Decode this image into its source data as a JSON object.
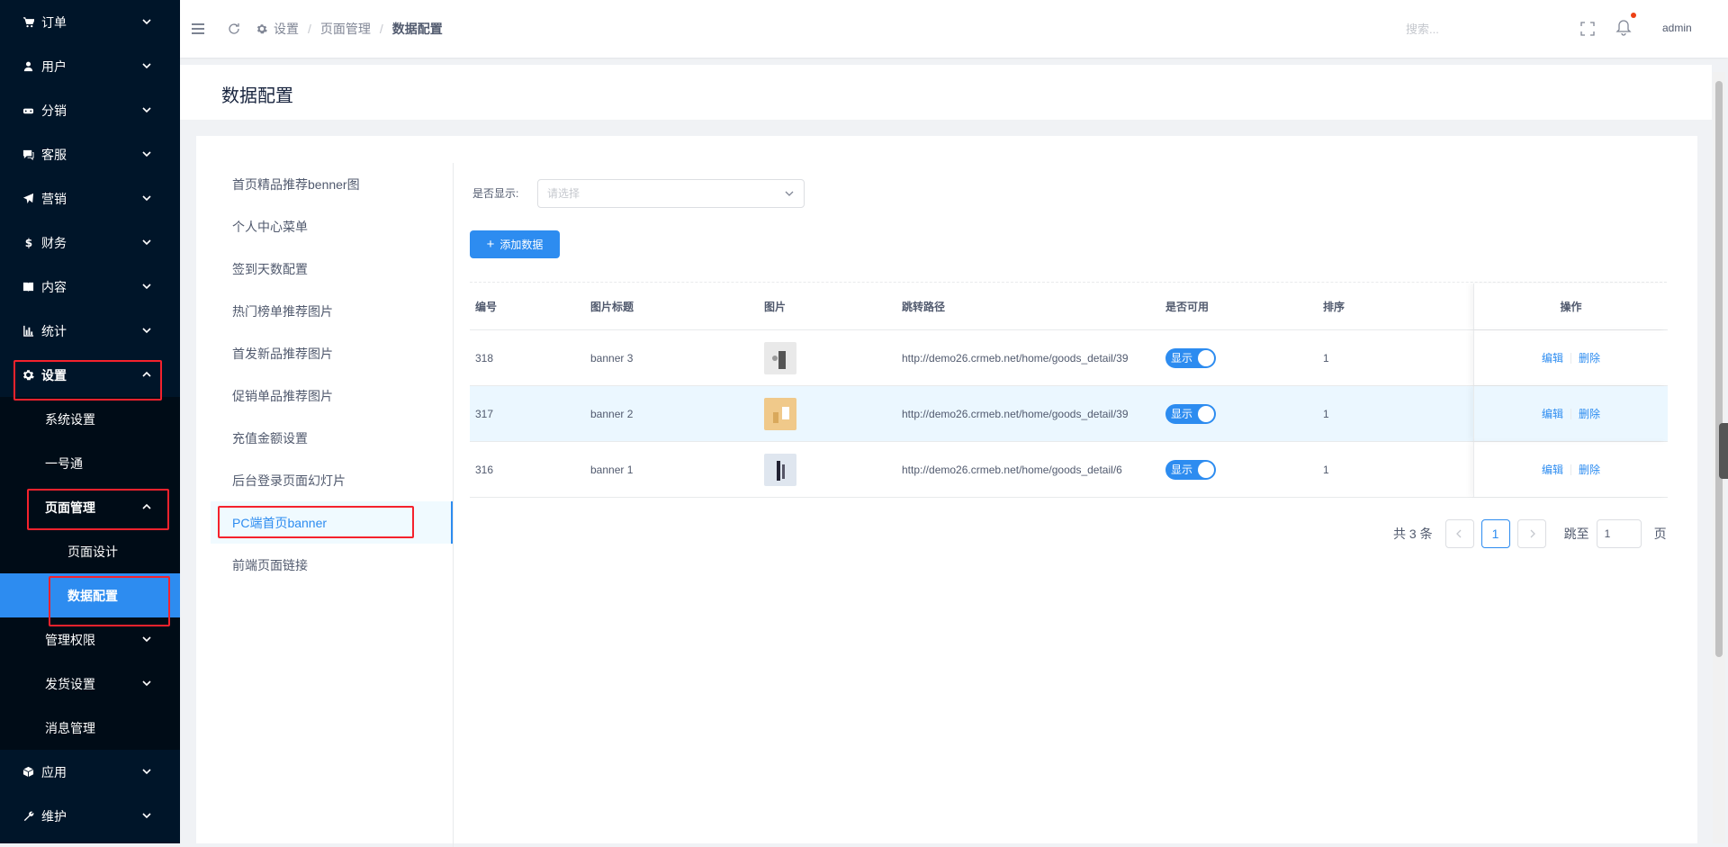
{
  "sidebar": {
    "top_items": [
      {
        "label": "订单",
        "icon": "cart-icon"
      },
      {
        "label": "用户",
        "icon": "user-icon"
      },
      {
        "label": "分销",
        "icon": "distribution-icon"
      },
      {
        "label": "客服",
        "icon": "chat-icon"
      },
      {
        "label": "营销",
        "icon": "send-icon"
      },
      {
        "label": "财务",
        "icon": "dollar-icon"
      },
      {
        "label": "内容",
        "icon": "book-icon"
      },
      {
        "label": "统计",
        "icon": "bar-chart-icon"
      }
    ],
    "settings_label": "设置",
    "settings_sub": {
      "system": "系统设置",
      "yihaotong": "一号通",
      "page_manage": "页面管理",
      "page_design": "页面设计",
      "data_config": "数据配置",
      "admin_perm": "管理权限",
      "shipping": "发货设置",
      "message": "消息管理"
    },
    "bottom_items": [
      {
        "label": "应用",
        "icon": "cube-icon"
      },
      {
        "label": "维护",
        "icon": "wrench-icon"
      }
    ]
  },
  "header": {
    "breadcrumb": [
      "设置",
      "页面管理",
      "数据配置"
    ],
    "search_placeholder": "搜索...",
    "user": "admin"
  },
  "page": {
    "title": "数据配置"
  },
  "left_nav": [
    "首页精品推荐benner图",
    "个人中心菜单",
    "签到天数配置",
    "热门榜单推荐图片",
    "首发新品推荐图片",
    "促销单品推荐图片",
    "充值金额设置",
    "后台登录页面幻灯片",
    "PC端首页banner",
    "前端页面链接"
  ],
  "filter": {
    "label": "是否显示:",
    "placeholder": "请选择"
  },
  "add_button": "添加数据",
  "table": {
    "headers": [
      "编号",
      "图片标题",
      "图片",
      "跳转路径",
      "是否可用",
      "排序",
      "操作"
    ],
    "rows": [
      {
        "id": "318",
        "title": "banner 3",
        "url": "http://demo26.crmeb.net/home/goods_detail/39",
        "status": "显示",
        "sort": "1",
        "edit": "编辑",
        "delete": "删除"
      },
      {
        "id": "317",
        "title": "banner 2",
        "url": "http://demo26.crmeb.net/home/goods_detail/39",
        "status": "显示",
        "sort": "1",
        "edit": "编辑",
        "delete": "删除"
      },
      {
        "id": "316",
        "title": "banner 1",
        "url": "http://demo26.crmeb.net/home/goods_detail/6",
        "status": "显示",
        "sort": "1",
        "edit": "编辑",
        "delete": "删除"
      }
    ]
  },
  "pagination": {
    "total": "共 3 条",
    "current": "1",
    "jump_label": "跳至",
    "jump_value": "1",
    "page_suffix": "页"
  },
  "colors": {
    "primary": "#2d8cf0",
    "sidebar_bg": "#001529",
    "highlight_box": "#f5222d"
  }
}
